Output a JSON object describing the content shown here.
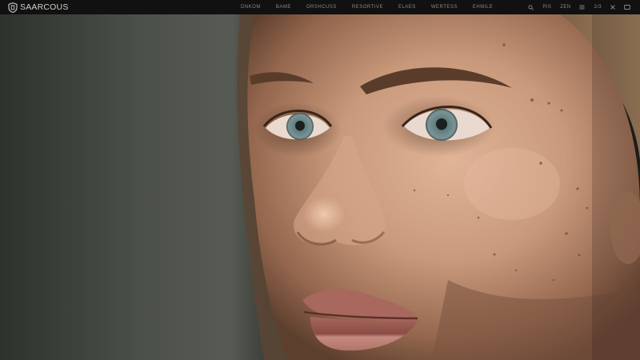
{
  "brand": {
    "name": "SAARCOUS",
    "icon": "shield-logo-icon"
  },
  "nav": {
    "items": [
      {
        "label": "DNKOM"
      },
      {
        "label": "BAME"
      },
      {
        "label": "ORSHCUSS"
      },
      {
        "label": "RESORTIVE"
      },
      {
        "label": "ELAES"
      },
      {
        "label": "WERTESS"
      },
      {
        "label": "EHMILE"
      }
    ]
  },
  "tools": {
    "search_icon": "search-icon",
    "lang_label": "PIS",
    "account_label": "ZEN",
    "menu_icon": "menu-icon",
    "count_label": "2/3",
    "close_icon": "close-icon",
    "window_icon": "window-icon"
  },
  "hero": {
    "image": "close-up-portrait-photo",
    "colors": {
      "background": "#4a4e48",
      "skin": "#c79a7e",
      "iris": "#6f8a8c",
      "lips": "#b5776e",
      "hair": "#8b6a4c"
    }
  }
}
